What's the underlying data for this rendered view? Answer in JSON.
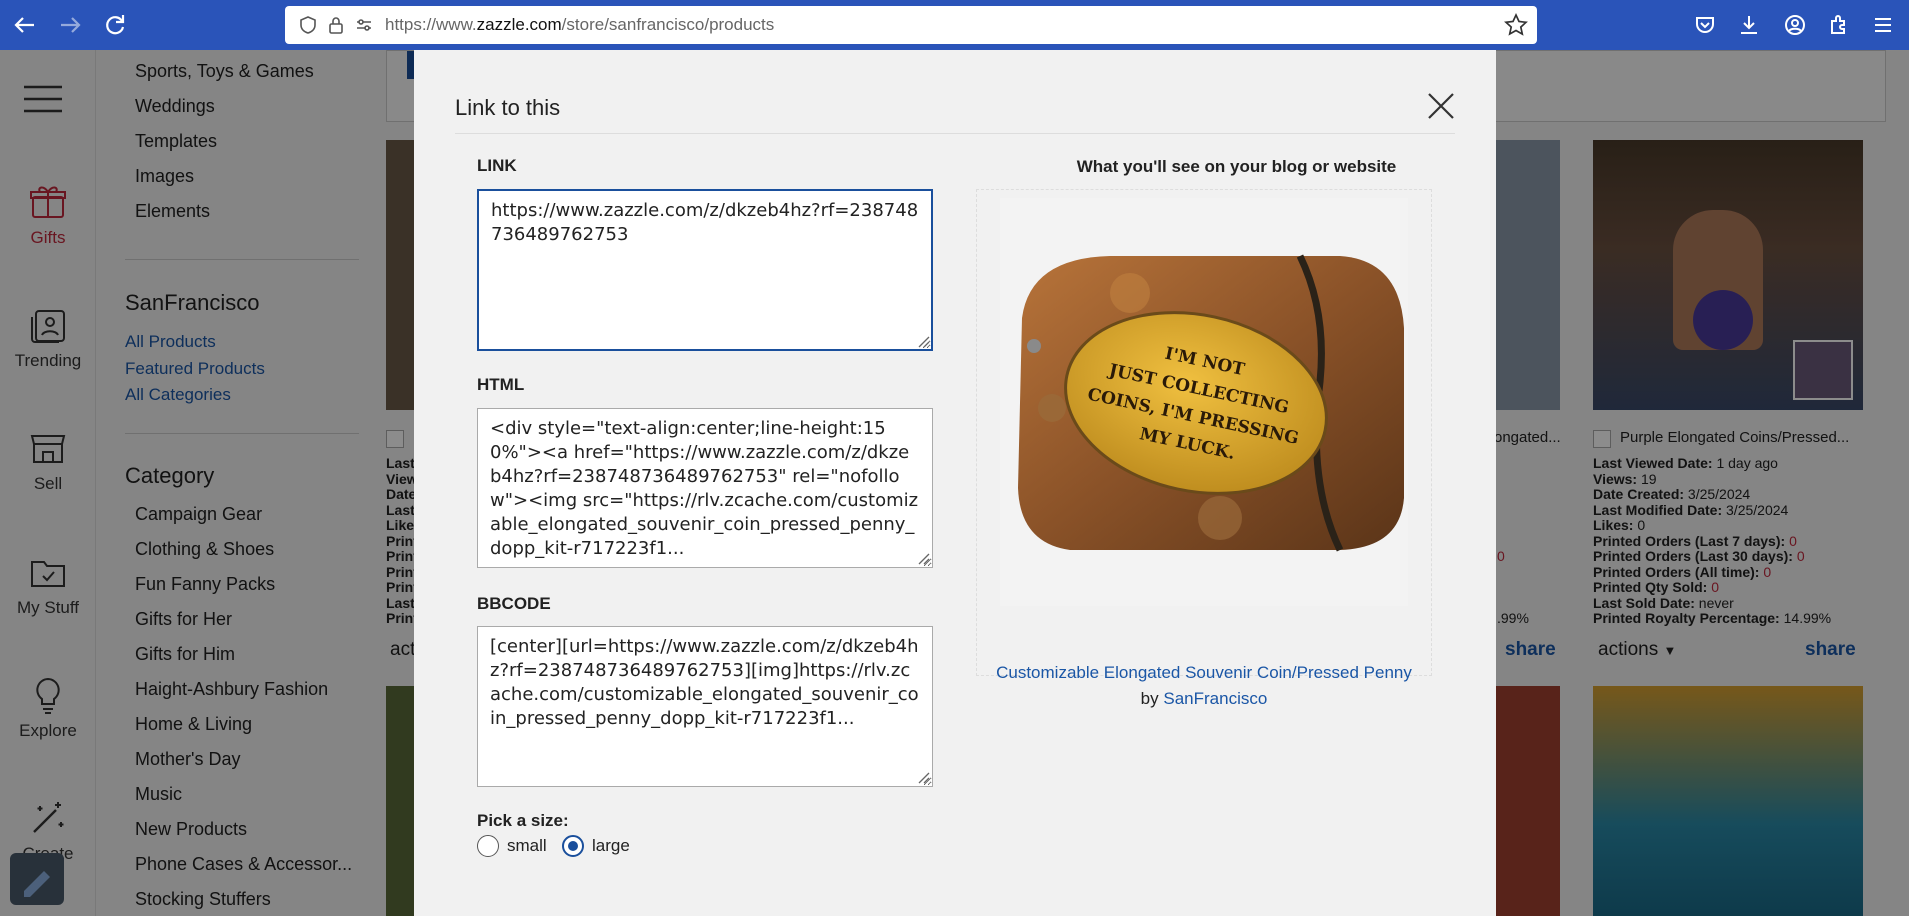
{
  "browser": {
    "url_prefix": "https://www.",
    "url_domain": "zazzle.com",
    "url_path": "/store/sanfrancisco/products"
  },
  "rail": {
    "items": [
      {
        "label": "Gifts"
      },
      {
        "label": "Trending"
      },
      {
        "label": "Sell"
      },
      {
        "label": "My Stuff"
      },
      {
        "label": "Explore"
      },
      {
        "label": "Create"
      }
    ]
  },
  "sidebar": {
    "top_items": [
      "Sports, Toys & Games",
      "Weddings",
      "Templates",
      "Images",
      "Elements"
    ],
    "store_title": "SanFrancisco",
    "store_links": [
      "All Products",
      "Featured Products",
      "All Categories"
    ],
    "category_title": "Category",
    "categories": [
      "Campaign Gear",
      "Clothing & Shoes",
      "Fun Fanny Packs",
      "Gifts for Her",
      "Gifts for Him",
      "Haight-Ashbury Fashion",
      "Home & Living",
      "Mother's Day",
      "Music",
      "New Products",
      "Phone Cases & Accessor...",
      "Stocking Stuffers"
    ]
  },
  "background_card": {
    "title": "Purple Elongated Coins/Pressed...",
    "title_partial": "ongated...",
    "stats": [
      {
        "label": "Last Viewed Date:",
        "value": "1 day ago"
      },
      {
        "label": "Views:",
        "value": "19"
      },
      {
        "label": "Date Created:",
        "value": "3/25/2024"
      },
      {
        "label": "Last Modified Date:",
        "value": "3/25/2024"
      },
      {
        "label": "Likes:",
        "value": "0"
      },
      {
        "label": "Printed Orders (Last 7 days):",
        "value": "0"
      },
      {
        "label": "Printed Orders (Last 30 days):",
        "value": "0"
      },
      {
        "label": "Printed Orders (All time):",
        "value": "0"
      },
      {
        "label": "Printed Qty Sold:",
        "value": "0"
      },
      {
        "label": "Last Sold Date:",
        "value": "never"
      },
      {
        "label": "Printed Royalty Percentage:",
        "value": "14.99%"
      }
    ],
    "actions_label": "actions",
    "actions_partial": "act",
    "share_label": "share",
    "partial_zero": "0",
    "partial_pct": ".99%",
    "left_partial_lines": [
      "Last",
      "View",
      "Date",
      "Last",
      "Like",
      "Print",
      "Print",
      "Print",
      "Print",
      "Last",
      "Print"
    ]
  },
  "modal": {
    "title": "Link to this",
    "link_label": "LINK",
    "link_value": "https://www.zazzle.com/z/dkzeb4hz?rf=238748736489762753",
    "html_label": "HTML",
    "html_value": "<div style=\"text-align:center;line-height:150%\"><a href=\"https://www.zazzle.com/z/dkzeb4hz?rf=238748736489762753\" rel=\"nofollow\"><img src=\"https://rlv.zcache.com/customizable_elongated_souvenir_coin_pressed_penny_dopp_kit-r717223f1...",
    "bbcode_label": "BBCODE",
    "bbcode_value": "[center][url=https://www.zazzle.com/z/dkzeb4hz?rf=238748736489762753][img]https://rlv.zcache.com/customizable_elongated_souvenir_coin_pressed_penny_dopp_kit-r717223f1...",
    "size_label": "Pick a size:",
    "size_options": [
      "small",
      "large"
    ],
    "size_selected": "large",
    "preview_title": "What you'll see on your blog or website",
    "product_name": "Customizable Elongated Souvenir Coin/Pressed Penny",
    "by_text": "by",
    "store_name": "SanFrancisco",
    "coin_text_lines": [
      "I'M NOT",
      "JUST COLLECTING",
      "COINS, I'M PRESSING",
      "MY LUCK."
    ]
  },
  "colors": {
    "browser_bar": "#2a54b9",
    "link_blue": "#1a56a6",
    "accent_red": "#c0283c",
    "focus_border": "#1a4f9c"
  }
}
